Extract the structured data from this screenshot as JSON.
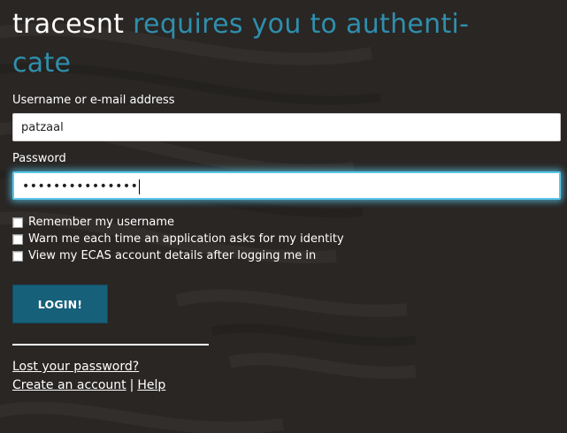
{
  "header": {
    "app_name": "tracesnt",
    "title_rest_line1": " requires you to authenti-",
    "title_rest_line2": "cate"
  },
  "form": {
    "username_label": "Username or e-mail address",
    "username_value": "patzaal",
    "password_label": "Password",
    "password_masked": "•••••••••••••••",
    "checkboxes": [
      {
        "label": "Remember my username",
        "checked": false
      },
      {
        "label": "Warn me each time an application asks for my identity",
        "checked": false
      },
      {
        "label": "View my ECAS account details after logging me in",
        "checked": false
      }
    ],
    "login_label": "LOGIN!"
  },
  "links": {
    "lost_password": "Lost your password?",
    "create_account": "Create an account",
    "separator": "|",
    "help": "Help"
  },
  "colors": {
    "background": "#292624",
    "title_accent": "#2f8fad",
    "button": "#17607a",
    "focus_glow": "#5bc7e8"
  }
}
